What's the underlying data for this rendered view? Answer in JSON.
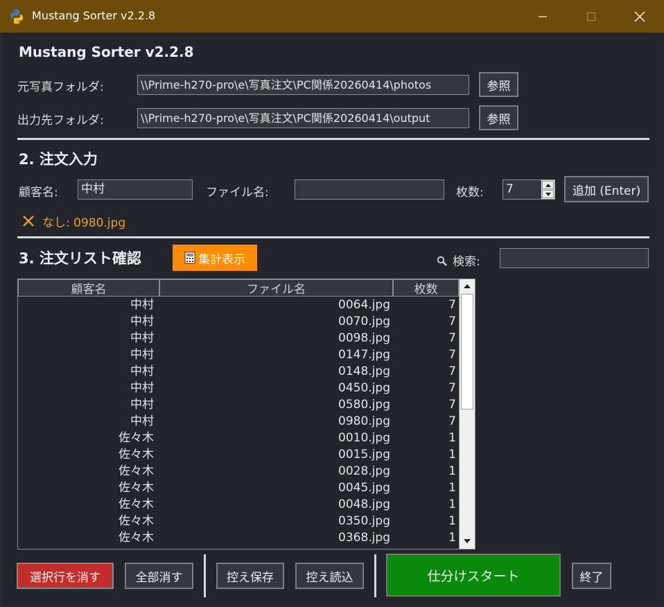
{
  "window": {
    "title": "Mustang Sorter v2.2.8",
    "frame_color": "#6e4a0b"
  },
  "header": {
    "title": "Mustang Sorter v2.2.8"
  },
  "folders": {
    "source_label": "元写真フォルダ:",
    "source_value": "\\\\Prime-h270-pro\\e\\写真注文\\PC関係20260414\\photos",
    "source_browse": "参照",
    "output_label": "出力先フォルダ:",
    "output_value": "\\\\Prime-h270-pro\\e\\写真注文\\PC関係20260414\\output",
    "output_browse": "参照"
  },
  "order_input": {
    "section_title": "2. 注文入力",
    "customer_label": "顧客名:",
    "customer_value": "中村",
    "file_label": "ファイル名:",
    "file_value": "",
    "count_label": "枚数:",
    "count_value": "7",
    "add_button": "追加 (Enter)",
    "status_icon": "cross-icon",
    "status_text": "なし: 0980.jpg",
    "status_color": "#f0a020"
  },
  "order_list": {
    "section_title": "3. 注文リスト確認",
    "summary_button": "集計表示",
    "summary_color": "#ff8c00",
    "search_label": "検索:",
    "search_value": "",
    "columns": [
      "顧客名",
      "ファイル名",
      "枚数"
    ],
    "rows": [
      [
        "中村",
        "0064.jpg",
        "7"
      ],
      [
        "中村",
        "0070.jpg",
        "7"
      ],
      [
        "中村",
        "0098.jpg",
        "7"
      ],
      [
        "中村",
        "0147.jpg",
        "7"
      ],
      [
        "中村",
        "0148.jpg",
        "7"
      ],
      [
        "中村",
        "0450.jpg",
        "7"
      ],
      [
        "中村",
        "0580.jpg",
        "7"
      ],
      [
        "中村",
        "0980.jpg",
        "7"
      ],
      [
        "佐々木",
        "0010.jpg",
        "1"
      ],
      [
        "佐々木",
        "0015.jpg",
        "1"
      ],
      [
        "佐々木",
        "0028.jpg",
        "1"
      ],
      [
        "佐々木",
        "0045.jpg",
        "1"
      ],
      [
        "佐々木",
        "0048.jpg",
        "1"
      ],
      [
        "佐々木",
        "0350.jpg",
        "1"
      ],
      [
        "佐々木",
        "0368.jpg",
        "1"
      ]
    ]
  },
  "footer": {
    "delete_selected": "選択行を消す",
    "delete_selected_color": "#c42b2b",
    "delete_all": "全部消す",
    "save_backup": "控え保存",
    "load_backup": "控え読込",
    "start": "仕分けスタート",
    "start_color": "#0a8a0a",
    "exit": "終了"
  }
}
